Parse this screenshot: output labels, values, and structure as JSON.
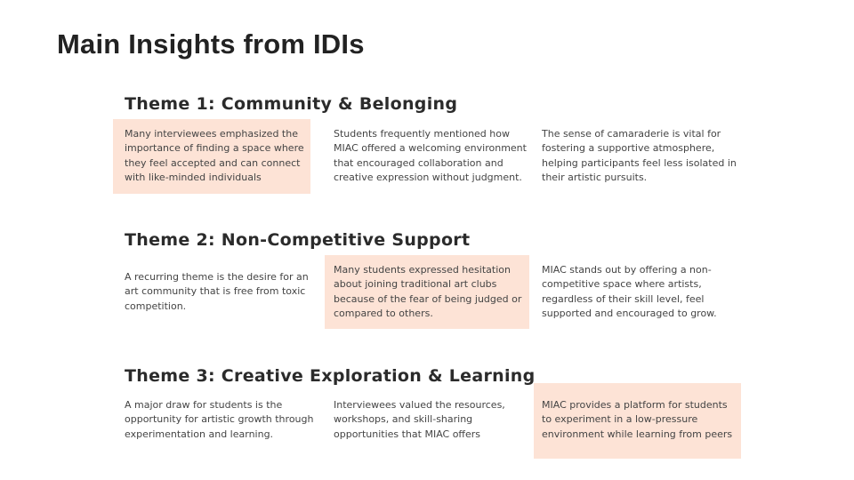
{
  "slide": {
    "title": "Main Insights from IDIs",
    "highlight_color": "#fde3d6"
  },
  "themes": [
    {
      "heading": "Theme 1: Community & Belonging",
      "insights": [
        "Many interviewees emphasized the importance of finding a space where they feel accepted and can connect with like-minded individuals",
        "Students frequently mentioned how MIAC offered a welcoming environment that encouraged collaboration and creative expression without judgment.",
        "The sense of camaraderie is vital for fostering a supportive atmosphere, helping participants feel less isolated in their artistic pursuits."
      ]
    },
    {
      "heading": "Theme 2: Non-Competitive Support",
      "insights": [
        "A recurring theme is the desire for an art community that is free from toxic competition.",
        "Many students expressed hesitation about joining traditional art clubs because of the fear of being judged or compared to others.",
        "MIAC stands out by offering a non-competitive space where artists, regardless of their skill level, feel supported and encouraged to grow."
      ]
    },
    {
      "heading": "Theme 3: Creative Exploration & Learning",
      "insights": [
        "A major draw for students is the opportunity for artistic growth through experimentation and learning.",
        "Interviewees valued the resources, workshops, and skill-sharing opportunities that MIAC offers",
        "MIAC provides a platform for students to experiment in a low-pressure environment while learning from peers"
      ]
    }
  ]
}
